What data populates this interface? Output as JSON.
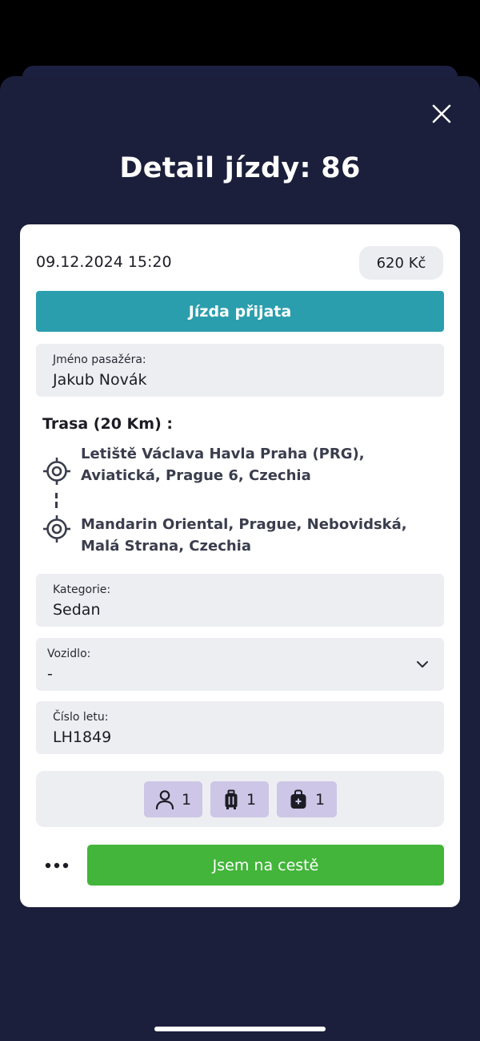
{
  "header": {
    "title": "Detail jízdy: 86",
    "close_icon": "close-icon"
  },
  "ride": {
    "datetime": "09.12.2024 15:20",
    "price": "620 Kč",
    "status": "Jízda přijata",
    "status_color": "#2b9eae"
  },
  "passenger": {
    "label": "Jméno pasažéra:",
    "value": "Jakub Novák"
  },
  "route": {
    "title": "Trasa (20 Km) :",
    "from_line1": "Letiště Václava Havla Praha (PRG),",
    "from_line2": "Aviatická, Prague 6, Czechia",
    "to_line1": "Mandarin Oriental, Prague, Nebovidská,",
    "to_line2": "Malá Strana, Czechia",
    "icon": "location-target-icon"
  },
  "category": {
    "label": "Kategorie:",
    "value": "Sedan"
  },
  "vehicle": {
    "label": "Vozidlo:",
    "value": "-",
    "icon": "chevron-down-icon"
  },
  "flight": {
    "label": "Číslo letu:",
    "value": "LH1849"
  },
  "counts": {
    "passengers": "1",
    "luggage": "1",
    "hand_luggage": "1",
    "chip_color": "#cdc6e6"
  },
  "actions": {
    "more_icon": "more-dots-icon",
    "primary_label": "Jsem na cestě",
    "primary_color": "#42b53a"
  }
}
